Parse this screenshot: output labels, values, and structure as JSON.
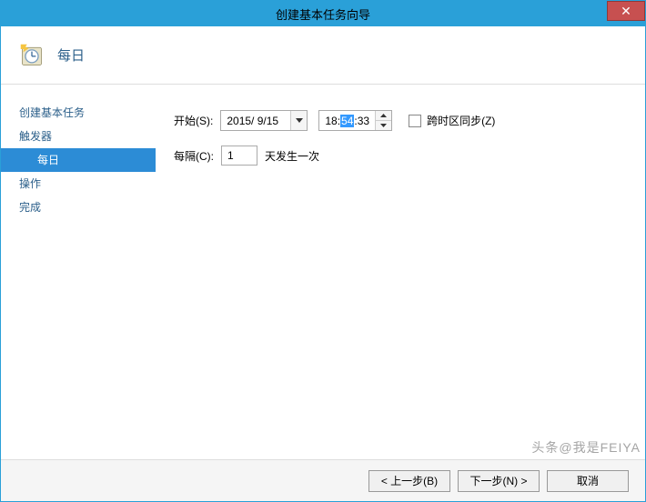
{
  "window": {
    "title": "创建基本任务向导",
    "close_symbol": "✕"
  },
  "header": {
    "title": "每日"
  },
  "sidebar": {
    "items": [
      {
        "label": "创建基本任务",
        "indent": false,
        "selected": false
      },
      {
        "label": "触发器",
        "indent": false,
        "selected": false
      },
      {
        "label": "每日",
        "indent": true,
        "selected": true
      },
      {
        "label": "操作",
        "indent": false,
        "selected": false
      },
      {
        "label": "完成",
        "indent": false,
        "selected": false
      }
    ]
  },
  "form": {
    "start_label": "开始(S):",
    "date_value": "2015/ 9/15",
    "time": {
      "h": "18",
      "m": "54",
      "s": "33"
    },
    "sync_label": "跨时区同步(Z)",
    "interval_label": "每隔(C):",
    "interval_value": "1",
    "interval_suffix": "天发生一次"
  },
  "footer": {
    "back": "< 上一步(B)",
    "next": "下一步(N) >",
    "cancel": "取消"
  },
  "watermark": "头条@我是FEIYA"
}
